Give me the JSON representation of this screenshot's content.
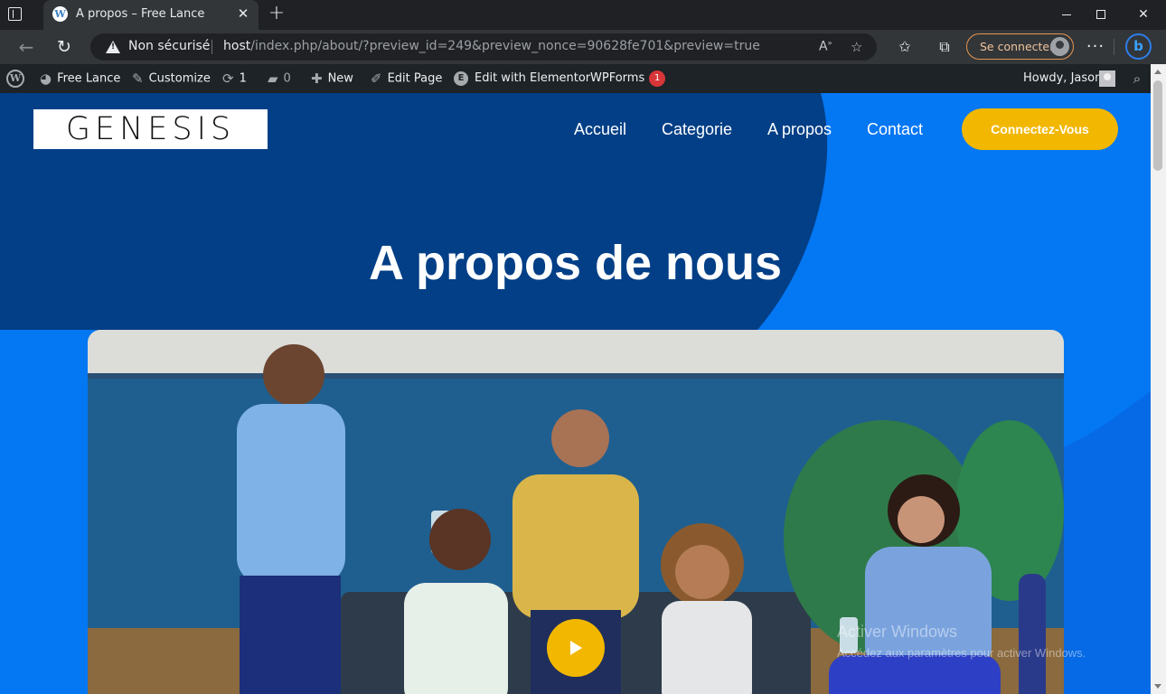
{
  "browser": {
    "tab_title": "A propos – Free Lance",
    "tab_close": "✕",
    "new_tab": "+",
    "security_label": "Non sécurisé",
    "url_host": "host",
    "url_path": "/index.php/about/?preview_id=249&preview_nonce=90628fe701&preview=true",
    "signin_label": "Se connecter",
    "more_label": "···"
  },
  "adminbar": {
    "site_name": "Free Lance",
    "customize": "Customize",
    "updates_count": "1",
    "comments_count": "0",
    "new_label": "New",
    "edit_page": "Edit Page",
    "edit_elementor": "Edit with Elementor",
    "wpforms": "WPForms",
    "wpforms_badge": "1",
    "howdy": "Howdy, Jason"
  },
  "site": {
    "logo_text": "GENESIS",
    "nav": [
      "Accueil",
      "Categorie",
      "A propos",
      "Contact"
    ],
    "cta": "Connectez-Vous",
    "hero_title": "A propos de nous"
  },
  "watermark": {
    "title": "Activer Windows",
    "subtitle": "Accédez aux paramètres pour activer Windows."
  },
  "colors": {
    "page_blue": "#0477f3",
    "page_dark": "#023f86",
    "accent_yellow": "#f2b700",
    "adminbar": "#1d2327"
  }
}
